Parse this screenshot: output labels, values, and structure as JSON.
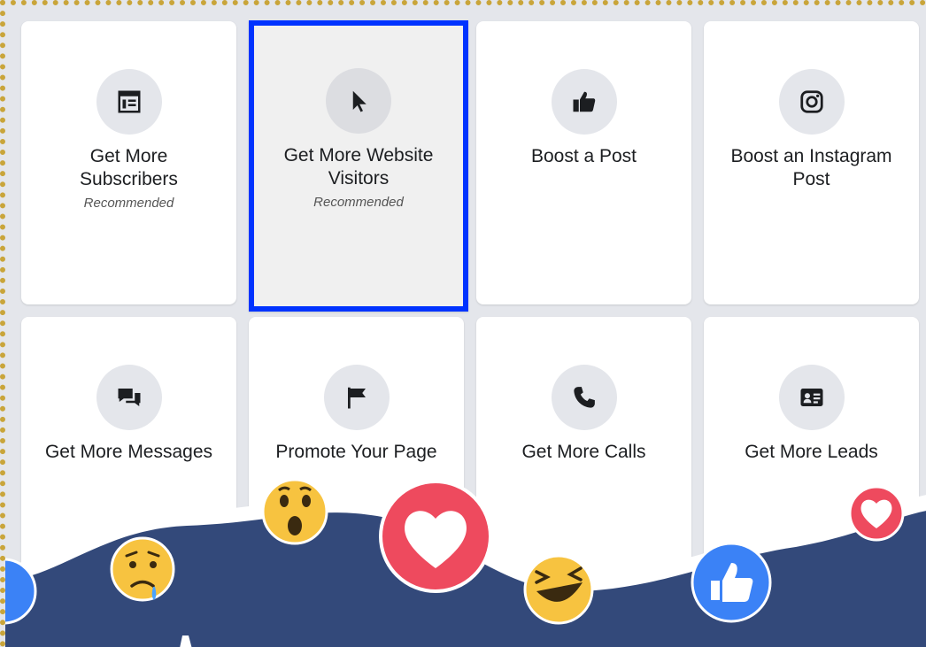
{
  "cards": [
    {
      "title_line1": "Get More",
      "title_line2": "Subscribers",
      "sub": "Recommended",
      "icon": "subscribers-icon"
    },
    {
      "title_line1": "Get More Website",
      "title_line2": "Visitors",
      "sub": "Recommended",
      "icon": "cursor-icon"
    },
    {
      "title_line1": "Boost a Post",
      "title_line2": "",
      "sub": "",
      "icon": "thumbs-up-icon"
    },
    {
      "title_line1": "Boost an Instagram",
      "title_line2": "Post",
      "sub": "",
      "icon": "instagram-icon"
    },
    {
      "title_line1": "Get More Messages",
      "title_line2": "",
      "sub": "",
      "icon": "chat-icon"
    },
    {
      "title_line1": "Promote Your Page",
      "title_line2": "",
      "sub": "",
      "icon": "flag-icon"
    },
    {
      "title_line1": "Get More Calls",
      "title_line2": "",
      "sub": "",
      "icon": "phone-icon"
    },
    {
      "title_line1": "Get More Leads",
      "title_line2": "",
      "sub": "",
      "icon": "contact-card-icon"
    }
  ],
  "selected_index": 1,
  "colors": {
    "selection_border": "#0033ff",
    "wave": "#33497a",
    "love": "#ee4a5e",
    "like": "#3b82f6"
  },
  "decorations": [
    "sad-emoji",
    "wow-emoji",
    "love-reaction",
    "haha-emoji",
    "like-reaction",
    "small-love-reaction"
  ]
}
